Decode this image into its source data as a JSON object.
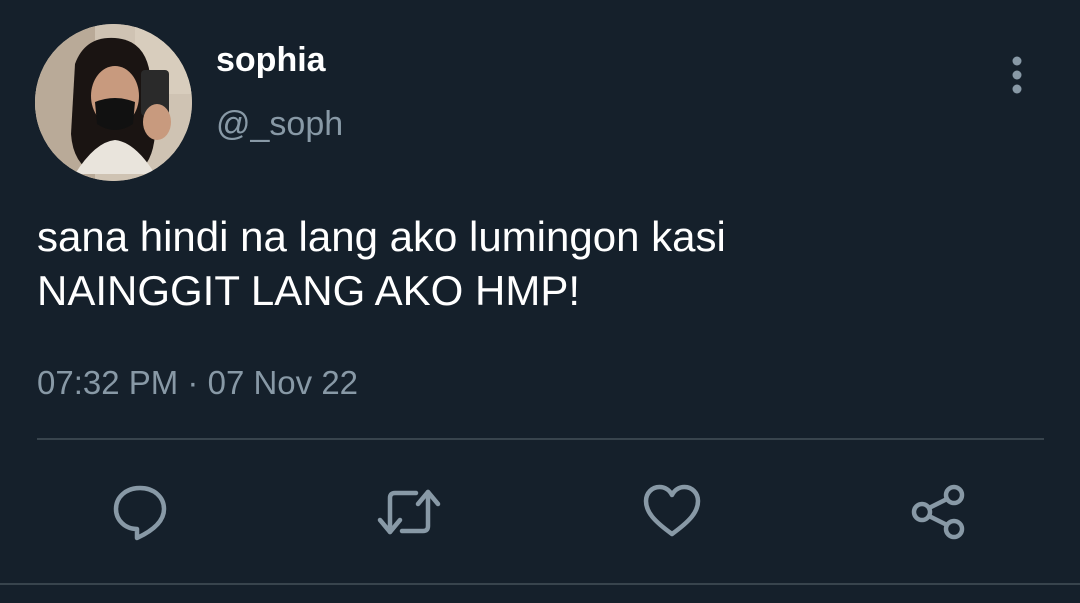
{
  "user": {
    "display_name": "sophia",
    "handle": "@_soph"
  },
  "tweet": {
    "text_lines": [
      "sana hindi na lang ako lumingon kasi",
      "NAINGGIT LANG AKO HMP!"
    ],
    "time": "07:32 PM",
    "separator": "·",
    "date": "07 Nov 22"
  },
  "actions": {
    "icons": [
      "reply-icon",
      "retweet-icon",
      "like-icon",
      "share-icon"
    ],
    "more_icon": "more-vertical-icon"
  },
  "colors": {
    "background": "#15202b",
    "primary_text": "#ffffff",
    "secondary_text": "#8899a6",
    "divider": "#38444d"
  }
}
